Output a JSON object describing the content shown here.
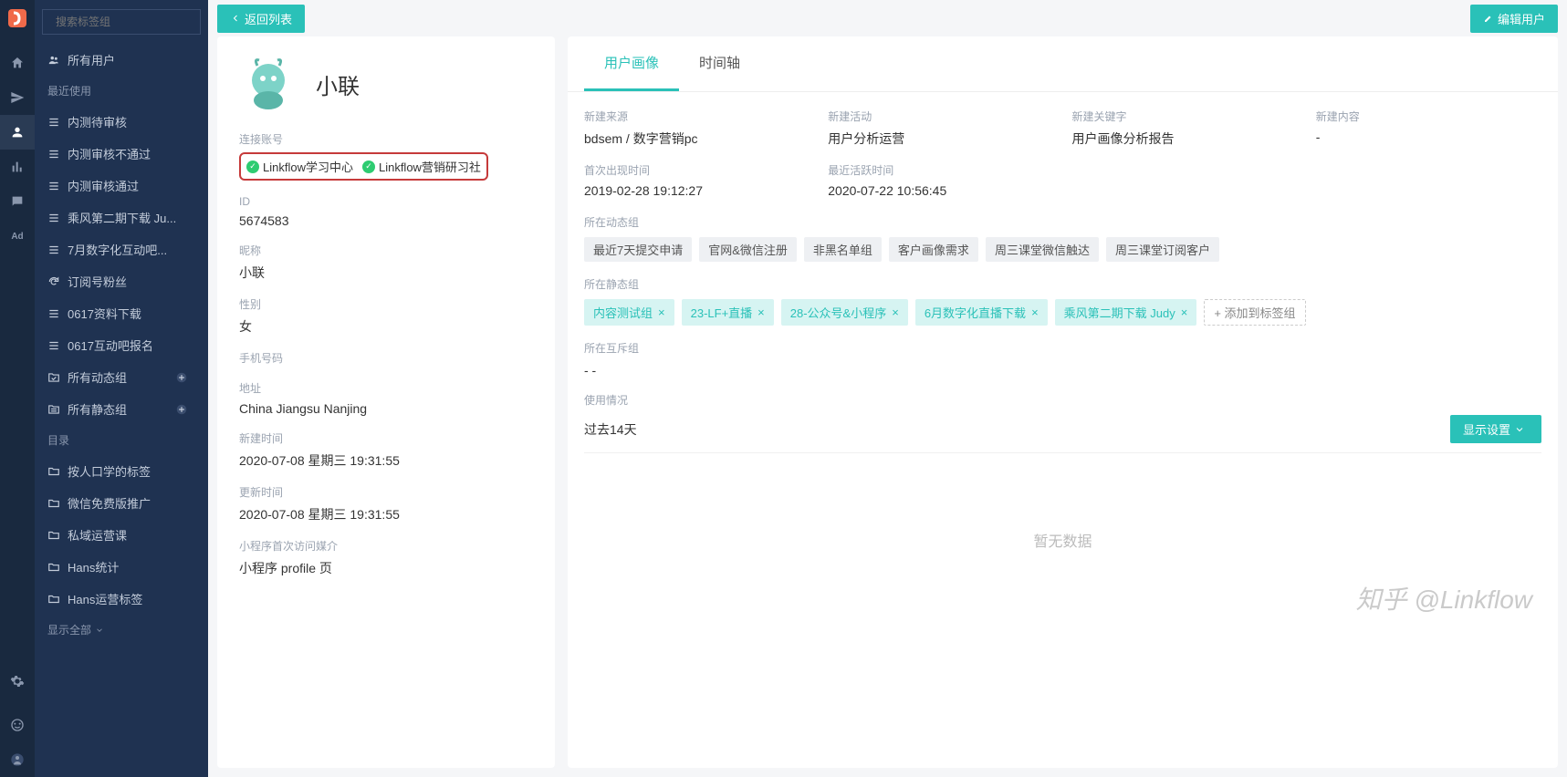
{
  "sidebar": {
    "search_placeholder": "搜索标签组",
    "all_users": "所有用户",
    "recent_label": "最近使用",
    "recent": [
      "内测待审核",
      "内测审核不通过",
      "内测审核通过",
      "乘风第二期下载 Ju...",
      "7月数字化互动吧...",
      "订阅号粉丝",
      "0617资料下载",
      "0617互动吧报名"
    ],
    "all_dynamic": "所有动态组",
    "all_static": "所有静态组",
    "catalog_label": "目录",
    "folders": [
      "按人口学的标签",
      "微信免费版推广",
      "私域运营课",
      "Hans统计",
      "Hans运营标签"
    ],
    "show_all": "显示全部"
  },
  "topbar": {
    "back": "返回列表",
    "edit": "编辑用户"
  },
  "profile": {
    "name": "小联",
    "linked_label": "连接账号",
    "linked": [
      "Linkflow学习中心",
      "Linkflow营销研习社"
    ],
    "fields": [
      {
        "label": "ID",
        "value": "5674583"
      },
      {
        "label": "昵称",
        "value": "小联"
      },
      {
        "label": "性别",
        "value": "女"
      },
      {
        "label": "手机号码",
        "value": ""
      },
      {
        "label": "地址",
        "value": "China Jiangsu Nanjing"
      },
      {
        "label": "新建时间",
        "value": "2020-07-08 星期三 19:31:55"
      },
      {
        "label": "更新时间",
        "value": "2020-07-08 星期三 19:31:55"
      },
      {
        "label": "小程序首次访问媒介",
        "value": "小程序 profile 页"
      }
    ]
  },
  "detail": {
    "tabs": [
      "用户画像",
      "时间轴"
    ],
    "grid": [
      {
        "label": "新建来源",
        "value": "bdsem / 数字营销pc"
      },
      {
        "label": "新建活动",
        "value": "用户分析运营"
      },
      {
        "label": "新建关键字",
        "value": "用户画像分析报告"
      },
      {
        "label": "新建内容",
        "value": "-"
      },
      {
        "label": "首次出现时间",
        "value": "2019-02-28 19:12:27"
      },
      {
        "label": "最近活跃时间",
        "value": "2020-07-22 10:56:45"
      }
    ],
    "dynamic_group_label": "所在动态组",
    "dynamic_groups": [
      "最近7天提交申请",
      "官网&微信注册",
      "非黑名单组",
      "客户画像需求",
      "周三课堂微信触达",
      "周三课堂订阅客户"
    ],
    "static_group_label": "所在静态组",
    "static_groups": [
      "内容测试组",
      "23-LF+直播",
      "28-公众号&小程序",
      "6月数字化直播下载",
      "乘风第二期下载 Judy"
    ],
    "add_tag": "+ 添加到标签组",
    "mutex_group_label": "所在互斥组",
    "mutex_value": "- -",
    "usage_label": "使用情况",
    "usage_period": "过去14天",
    "show_settings": "显示设置",
    "no_data": "暂无数据"
  },
  "watermark": "知乎 @Linkflow"
}
